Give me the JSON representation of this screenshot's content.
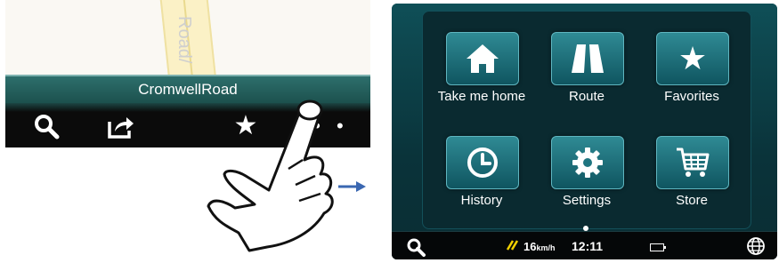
{
  "map": {
    "road_label": "Road/",
    "street_name": "CromwellRoad"
  },
  "left_toolbar": {
    "icons": [
      "search-icon",
      "share-icon",
      "star-icon",
      "more-dots-icon"
    ],
    "dots": "• •"
  },
  "menu": {
    "items": [
      {
        "label": "Take me home",
        "icon": "home-icon"
      },
      {
        "label": "Route",
        "icon": "route-icon"
      },
      {
        "label": "Favorites",
        "icon": "star-icon"
      },
      {
        "label": "History",
        "icon": "clock-icon"
      },
      {
        "label": "Settings",
        "icon": "gear-icon"
      },
      {
        "label": "Store",
        "icon": "cart-icon"
      }
    ]
  },
  "status": {
    "speed_value": "16",
    "speed_unit": "km/h",
    "time": "12:11"
  },
  "colors": {
    "accent": "#2f8a94",
    "street_bar": "#2d6f6c",
    "arrow": "#3a67b1"
  }
}
